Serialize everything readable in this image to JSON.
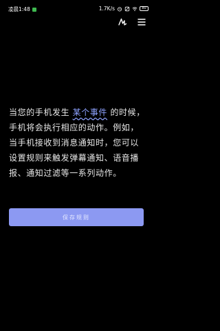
{
  "status_bar": {
    "time": "凌晨1:48",
    "network_speed": "1.7K/s",
    "battery": "80"
  },
  "toolbar": {
    "icons": [
      "draw-icon",
      "menu-icon"
    ]
  },
  "description": {
    "part1": "当您的手机发生 ",
    "highlight": "某个事件",
    "part2": " 的时候，手机将会执行相应的动作。例如，当手机接收到消息通知时，您可以设置规则来触发弹幕通知、语音播报、通知过滤等一系列动作。"
  },
  "save_button": {
    "label": "保存规则"
  },
  "colors": {
    "background": "#000000",
    "accent": "#8ea2ff",
    "button": "#8c99f2"
  }
}
